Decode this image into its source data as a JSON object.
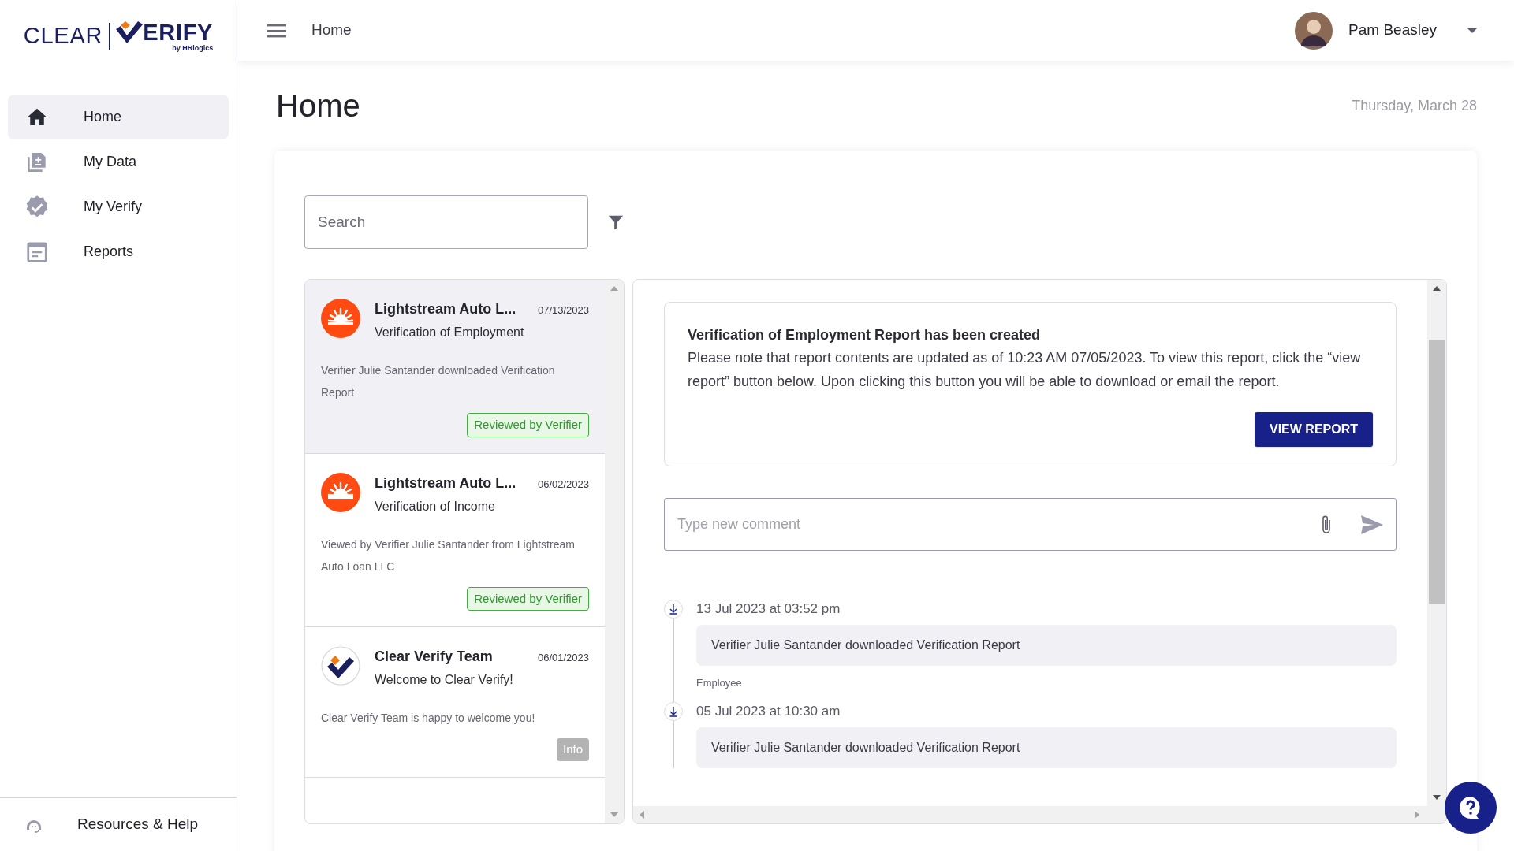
{
  "logo": {
    "left": "CLEAR",
    "right": "ERIFY",
    "byline": "by HRlogics"
  },
  "sidebar": {
    "items": [
      {
        "label": "Home",
        "selected": true
      },
      {
        "label": "My Data",
        "selected": false
      },
      {
        "label": "My Verify",
        "selected": false
      },
      {
        "label": "Reports",
        "selected": false
      }
    ],
    "footer": {
      "label": "Resources & Help"
    }
  },
  "header": {
    "breadcrumb": "Home",
    "user": {
      "name": "Pam Beasley"
    }
  },
  "page": {
    "title": "Home",
    "date": "Thursday, March 28"
  },
  "search": {
    "placeholder": "Search"
  },
  "notifications": [
    {
      "kind": "lender",
      "title": "Lightstream Auto L...",
      "date": "07/13/2023",
      "subtitle": "Verification of Employment",
      "description": "Verifier Julie Santander downloaded Verification Report",
      "badge": {
        "label": "Reviewed by Verifier",
        "kind": "success"
      },
      "selected": true
    },
    {
      "kind": "lender",
      "title": "Lightstream Auto L...",
      "date": "06/02/2023",
      "subtitle": "Verification of Income",
      "description": "Viewed by Verifier Julie Santander from Lightstream Auto Loan LLC",
      "badge": {
        "label": "Reviewed by Verifier",
        "kind": "success"
      },
      "selected": false
    },
    {
      "kind": "team",
      "title": "Clear Verify Team",
      "date": "06/01/2023",
      "subtitle": "Welcome to Clear Verify!",
      "description": "Clear Verify Team is happy to welcome you!",
      "badge": {
        "label": "Info",
        "kind": "info"
      },
      "selected": false
    }
  ],
  "detail": {
    "heading": "Verification of Employment Report has been created",
    "body": "Please note that report contents are updated as of 10:23 AM 07/05/2023. To view this report, click the “view report” button below. Upon clicking this button you will be able to download or email the report.",
    "button": "VIEW REPORT",
    "comment": {
      "placeholder": "Type new comment"
    },
    "timeline": [
      {
        "time": "13 Jul 2023 at 03:52 pm",
        "message": "Verifier Julie Santander downloaded Verification Report",
        "author": "Employee"
      },
      {
        "time": "05 Jul 2023 at 10:30 am",
        "message": "Verifier Julie Santander downloaded Verification Report"
      }
    ]
  }
}
